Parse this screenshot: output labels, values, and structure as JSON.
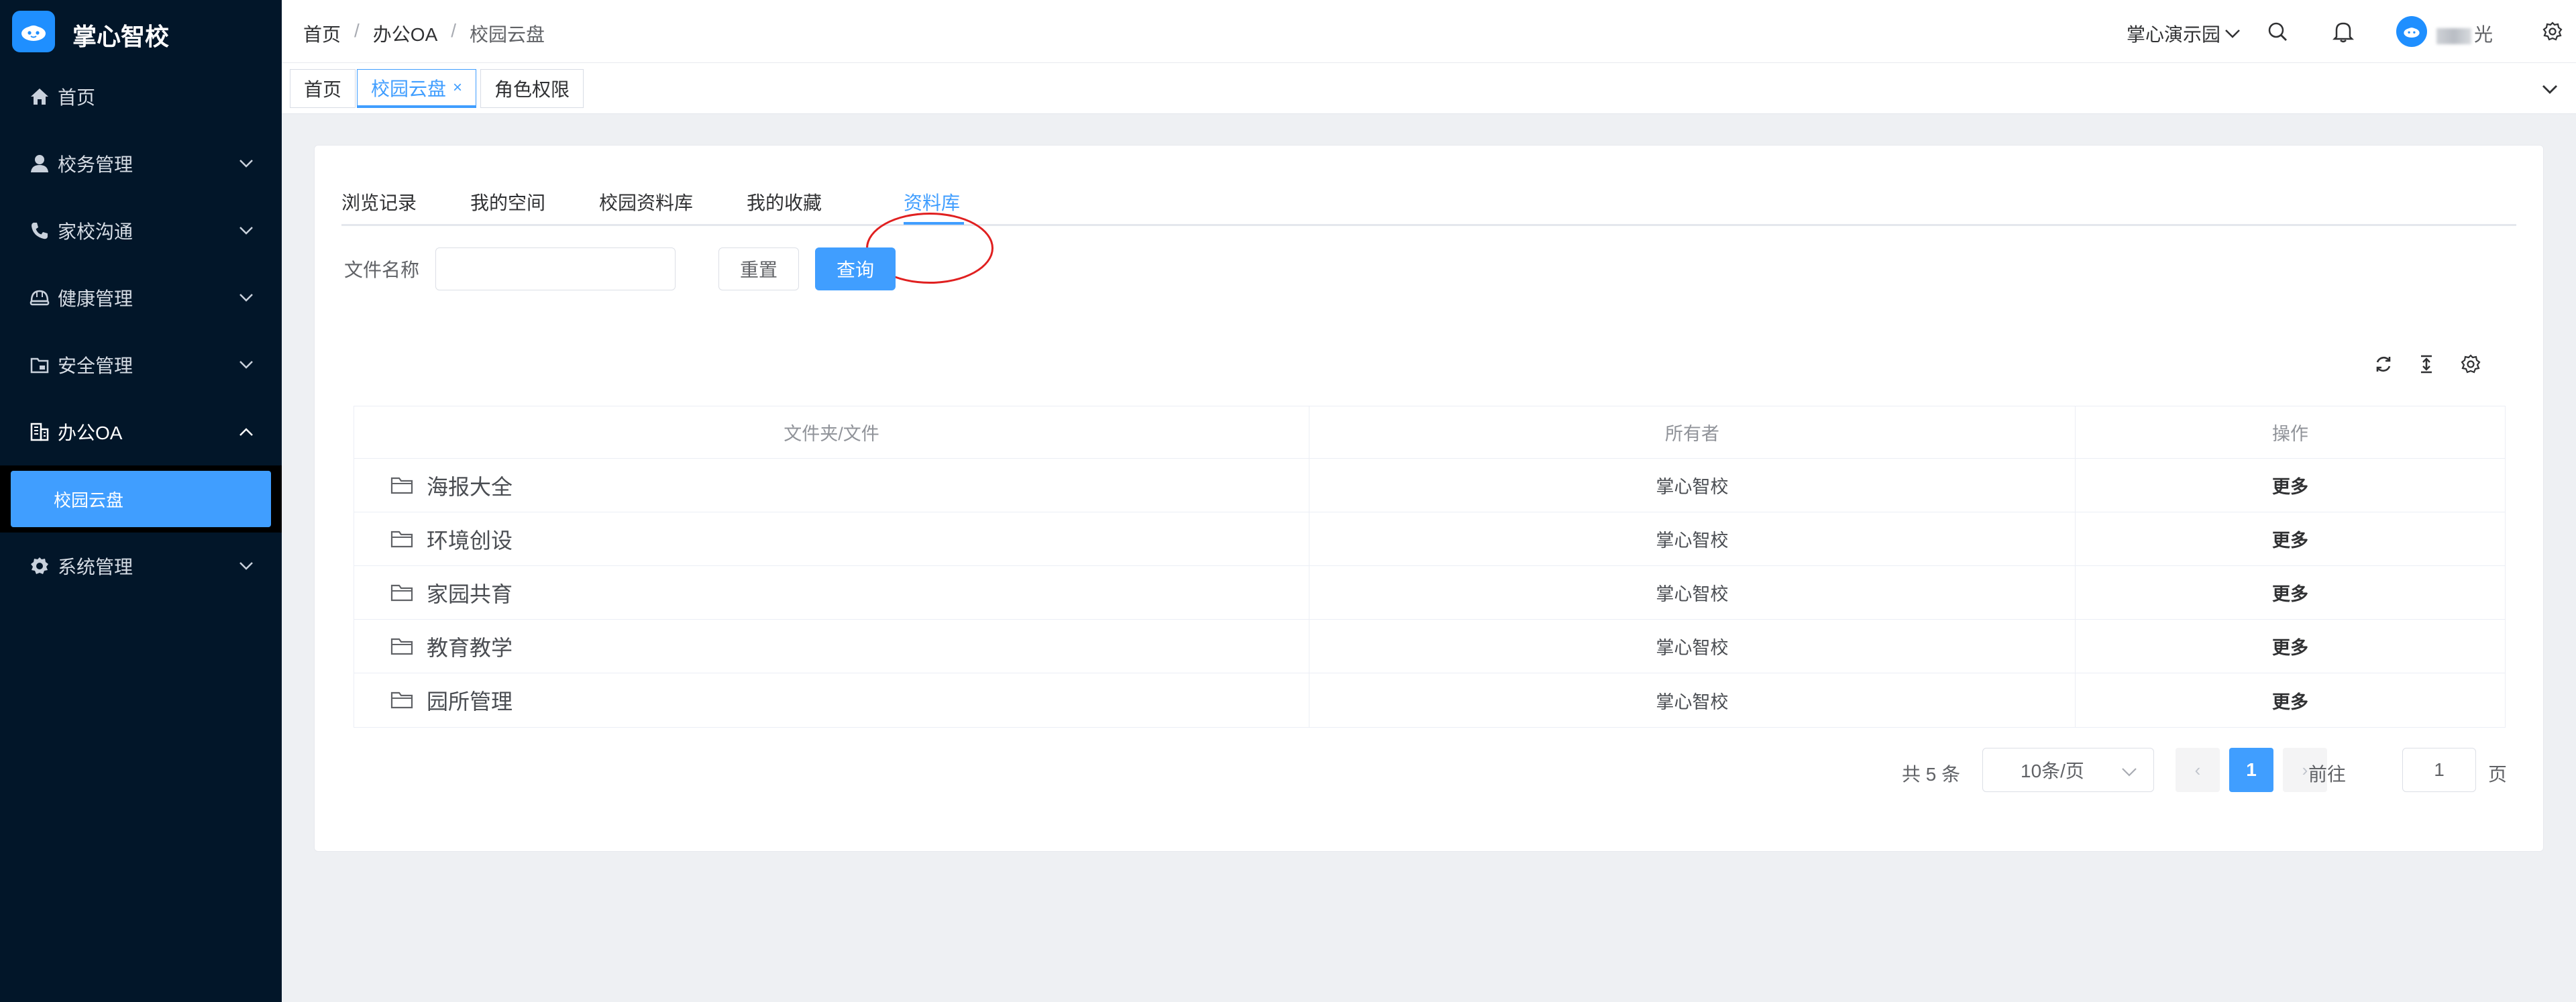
{
  "app": {
    "title": "掌心智校"
  },
  "sidebar": {
    "items": [
      {
        "label": "首页",
        "icon": "home-icon"
      },
      {
        "label": "校务管理",
        "icon": "user-icon"
      },
      {
        "label": "家校沟通",
        "icon": "phone-icon"
      },
      {
        "label": "健康管理",
        "icon": "helmet-icon"
      },
      {
        "label": "安全管理",
        "icon": "folder-lock-icon"
      },
      {
        "label": "办公OA",
        "icon": "building-icon",
        "expanded": true
      },
      {
        "label": "系统管理",
        "icon": "gear-icon"
      }
    ],
    "submenu": {
      "label": "校园云盘",
      "active": true
    }
  },
  "header": {
    "breadcrumb": [
      "首页",
      "办公OA",
      "校园云盘"
    ],
    "school": "掌心演示园",
    "username_suffix": "光"
  },
  "tabs": {
    "items": [
      {
        "label": "首页",
        "active": false
      },
      {
        "label": "校园云盘",
        "active": true,
        "close": "×"
      },
      {
        "label": "角色权限",
        "active": false
      }
    ]
  },
  "content": {
    "subtabs": [
      "浏览记录",
      "我的空间",
      "校园资料库",
      "我的收藏",
      "资料库"
    ],
    "active_subtab": "资料库",
    "filter": {
      "label": "文件名称",
      "value": "",
      "reset": "重置",
      "query": "查询"
    },
    "table": {
      "headers": [
        "文件夹/文件",
        "所有者",
        "操作"
      ],
      "rows": [
        {
          "name": "海报大全",
          "owner": "掌心智校",
          "action": "更多"
        },
        {
          "name": "环境创设",
          "owner": "掌心智校",
          "action": "更多"
        },
        {
          "name": "家园共育",
          "owner": "掌心智校",
          "action": "更多"
        },
        {
          "name": "教育教学",
          "owner": "掌心智校",
          "action": "更多"
        },
        {
          "name": "园所管理",
          "owner": "掌心智校",
          "action": "更多"
        }
      ]
    },
    "pagination": {
      "total": "共 5 条",
      "page_size": "10条/页",
      "current": "1",
      "prev": "‹",
      "next": "›",
      "goto_label": "前往",
      "goto_value": "1",
      "page_suffix": "页"
    }
  },
  "colors": {
    "sidebar_bg": "#021629",
    "accent": "#409eff",
    "annotation": "#e02020"
  }
}
